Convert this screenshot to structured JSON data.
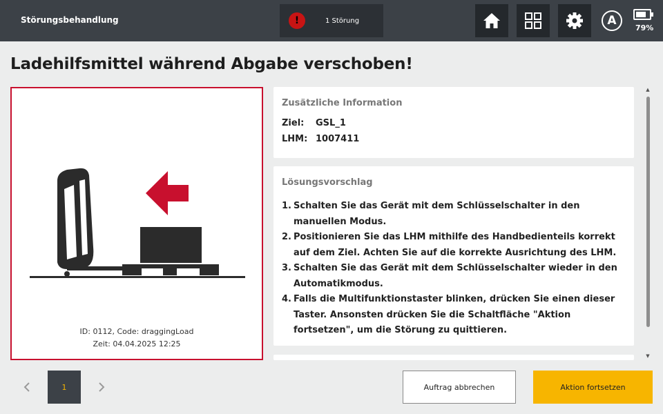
{
  "header": {
    "title": "Störungsbehandlung",
    "alert": {
      "icon": "exclamation-icon",
      "icon_glyph": "!",
      "text": "1 Störung"
    },
    "buttons": [
      {
        "name": "home-button",
        "icon": "home-icon"
      },
      {
        "name": "apps-button",
        "icon": "grid-icon"
      },
      {
        "name": "settings-button",
        "icon": "gear-icon"
      }
    ],
    "mode_letter": "A",
    "battery": {
      "percent_label": "79%",
      "level": 0.79
    }
  },
  "page": {
    "title": "Ladehilfsmittel während Abgabe verschoben!"
  },
  "image_panel": {
    "id_line": "ID: 0112, Code: draggingLoad",
    "time_line": "Zeit: 04.04.2025 12:25"
  },
  "info_card": {
    "heading": "Zusätzliche Information",
    "rows": [
      {
        "label": "Ziel:",
        "value": "GSL_1"
      },
      {
        "label": "LHM:",
        "value": "1007411"
      }
    ]
  },
  "solution_card": {
    "heading": "Lösungsvorschlag",
    "steps": [
      {
        "num": "1.",
        "text": "Schalten Sie das Gerät mit dem Schlüsselschalter in den manuellen Modus."
      },
      {
        "num": "2.",
        "text": "Positionieren Sie das LHM mithilfe des Handbedienteils korrekt auf dem Ziel. Achten Sie auf die korrekte Ausrichtung des LHM."
      },
      {
        "num": "3.",
        "text": "Schalten Sie das Gerät mit dem Schlüsselschalter wieder in den Automatikmodus."
      },
      {
        "num": "4.",
        "text": "Falls die Multifunktionstaster blinken, drücken Sie einen dieser Taster. Ansonsten drücken Sie die Schaltfläche \"Aktion fortsetzen\", um die Störung zu quittieren."
      }
    ]
  },
  "pagination": {
    "prev_icon": "chevron-left-icon",
    "next_icon": "chevron-right-icon",
    "current": "1"
  },
  "actions": {
    "cancel_label": "Auftrag abbrechen",
    "continue_label": "Aktion fortsetzen"
  },
  "colors": {
    "topbar": "#3c4147",
    "alert_red": "#c81414",
    "panel_border": "#c8102e",
    "arrow_red": "#c8102e",
    "accent_yellow": "#f7b500"
  }
}
